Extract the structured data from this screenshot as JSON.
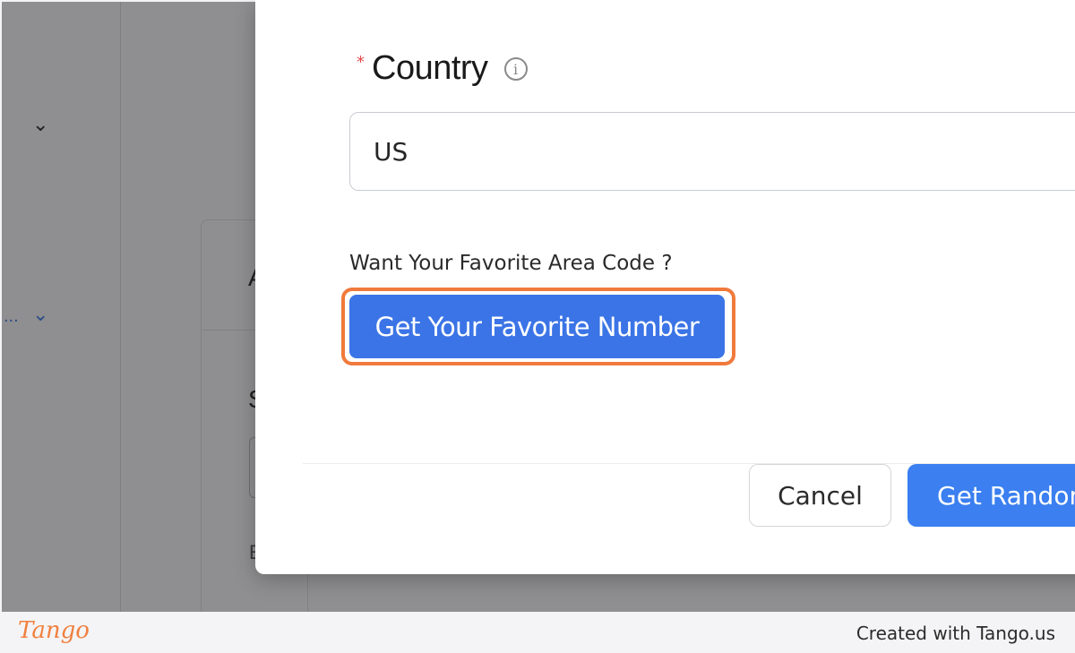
{
  "background": {
    "partial_letters": [
      "A",
      "S",
      "E"
    ],
    "ellipsis": "..."
  },
  "modal": {
    "country_field": {
      "required_marker": "*",
      "label": "Country",
      "info_icon": "info-circle-icon",
      "value": "US"
    },
    "area_code_prompt": "Want Your Favorite Area Code ?",
    "favorite_number_button": "Get Your Favorite Number",
    "footer": {
      "cancel_label": "Cancel",
      "random_label": "Get Random"
    }
  },
  "tango": {
    "logo": "Tango",
    "credit": "Created with Tango.us"
  },
  "colors": {
    "primary_button": "#3b74e6",
    "highlight_ring": "#f07a3c",
    "required_star": "#e5484d"
  }
}
